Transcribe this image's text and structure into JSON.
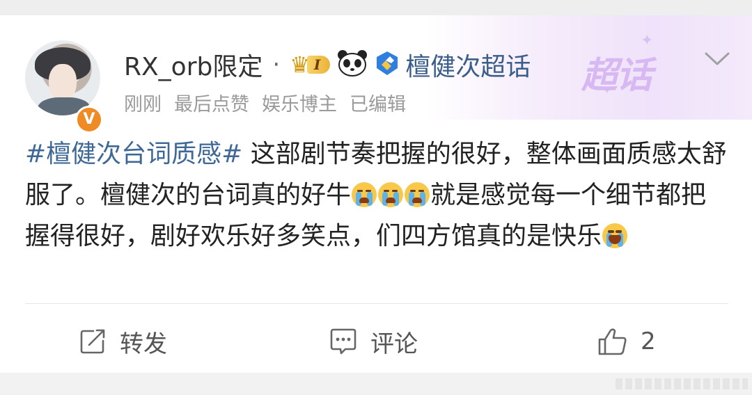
{
  "post": {
    "author": {
      "username": "RX_orb限定",
      "separator": "·",
      "rank_label": "I",
      "verified_badge": "V"
    },
    "supertopic": {
      "name": "檀健次超话",
      "banner_text": "超话"
    },
    "meta": {
      "time": "刚刚",
      "last_liked": "最后点赞",
      "category": "娱乐博主",
      "edited": "已编辑"
    },
    "content": {
      "hashtag": "#檀健次台词质感#",
      "text_1": " 这部剧节奏把握的很好，整体画面质感太舒服了。檀健次的台词真的好牛",
      "text_2": "就是感觉每一个细节都把握得很好，剧好欢乐好多笑点，们四方馆真的是快乐",
      "emojis": [
        "crying-emoji",
        "crying-emoji",
        "crying-emoji",
        "laughing-crying-emoji"
      ]
    },
    "actions": {
      "repost_label": "转发",
      "comment_label": "评论",
      "like_count": "2"
    }
  },
  "icons": {
    "repost": "share-icon",
    "comment": "comment-icon",
    "like": "thumbs-up-icon",
    "more": "chevron-down-icon"
  },
  "colors": {
    "hashtag": "#3e6896",
    "supertopic": "#3b5d8a",
    "meta": "#9a9a9a",
    "banner": "#d7b8f2",
    "verified": "#f08a24"
  }
}
